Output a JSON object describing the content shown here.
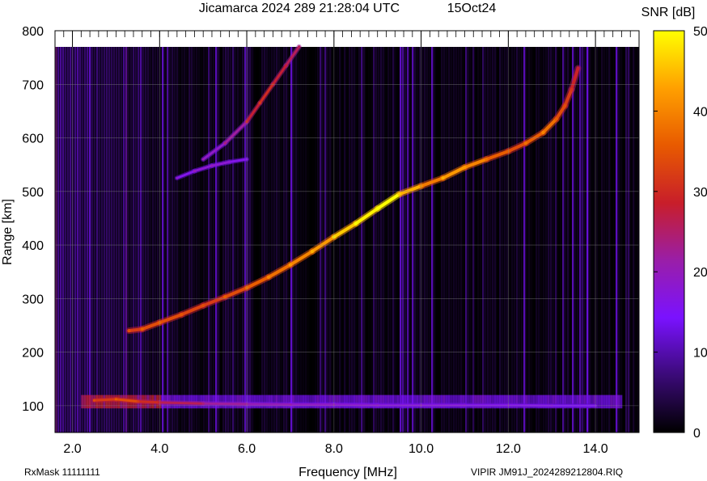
{
  "header": {
    "title": "Jicamarca 2024 289 21:28:04 UTC",
    "date": "15Oct24"
  },
  "footer": {
    "rxmask": "RxMask 11111111",
    "file": "VIPIR  JM91J_2024289212804.RIQ"
  },
  "colorbar": {
    "label": "SNR [dB]",
    "min": 0,
    "max": 50,
    "ticks": [
      "0",
      "10",
      "20",
      "30",
      "40",
      "50"
    ],
    "colors": [
      "#000000",
      "#3b0a78",
      "#7a12ff",
      "#9a1ea8",
      "#c81e2a",
      "#e85a00",
      "#ffa000",
      "#ffff00"
    ]
  },
  "chart_data": {
    "type": "heatmap",
    "title": "Jicamarca 2024 289 21:28:04 UTC",
    "xlabel": "Frequency [MHz]",
    "ylabel": "Range [km]",
    "xlim": [
      1.6,
      15.0
    ],
    "ylim": [
      50,
      800
    ],
    "x_ticks": [
      "2.0",
      "4.0",
      "6.0",
      "8.0",
      "10.0",
      "12.0",
      "14.0"
    ],
    "y_ticks": [
      "100",
      "200",
      "300",
      "400",
      "500",
      "600",
      "700",
      "800"
    ],
    "grid": true,
    "colorbar_label": "SNR [dB]",
    "traces": [
      {
        "name": "",
        "x": [
          3.3,
          3.6,
          4.0,
          4.5,
          5.0,
          5.5,
          6.0,
          6.5,
          7.0,
          7.5,
          8.0,
          8.5,
          9.0,
          9.5,
          10.0,
          10.5,
          11.0,
          11.5,
          12.0,
          12.4,
          12.8,
          13.1,
          13.3,
          13.45,
          13.6
        ],
        "y": [
          240,
          243,
          255,
          270,
          287,
          303,
          320,
          340,
          363,
          388,
          415,
          440,
          468,
          495,
          510,
          525,
          545,
          560,
          575,
          590,
          610,
          635,
          660,
          690,
          730
        ],
        "snr": [
          28,
          30,
          30,
          29,
          28,
          30,
          32,
          34,
          36,
          38,
          42,
          45,
          48,
          40,
          35,
          38,
          36,
          32,
          30,
          32,
          34,
          30,
          28,
          25,
          22
        ]
      },
      {
        "name": "",
        "x": [
          5.0,
          5.5,
          6.0,
          6.3,
          6.6,
          6.9,
          7.2
        ],
        "y": [
          560,
          590,
          630,
          665,
          700,
          735,
          770
        ],
        "snr": [
          15,
          18,
          24,
          26,
          24,
          22,
          20
        ]
      },
      {
        "name": "",
        "x": [
          4.4,
          4.8,
          5.2,
          5.6,
          6.0
        ],
        "y": [
          525,
          538,
          548,
          555,
          560
        ],
        "snr": [
          12,
          14,
          14,
          12,
          10
        ]
      },
      {
        "name": "",
        "x": [
          2.5,
          3.0,
          3.5,
          4.0,
          5.0,
          6.0,
          7.0,
          8.0,
          9.0,
          10.0,
          11.0,
          12.0,
          13.0,
          14.0
        ],
        "y": [
          110,
          112,
          108,
          106,
          104,
          103,
          102,
          102,
          101,
          101,
          101,
          101,
          100,
          100
        ],
        "snr": [
          28,
          30,
          26,
          22,
          18,
          16,
          15,
          14,
          13,
          13,
          12,
          12,
          11,
          10
        ]
      }
    ]
  }
}
